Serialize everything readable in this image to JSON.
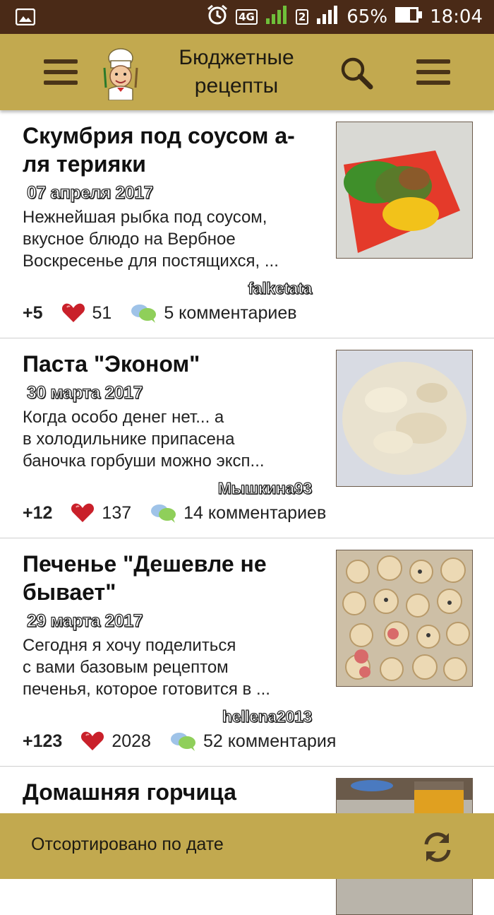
{
  "status_bar": {
    "network": "4G",
    "sim": "2",
    "battery": "65%",
    "time": "18:04"
  },
  "app": {
    "title_line1": "Бюджетные",
    "title_line2": "рецепты",
    "icons": [
      "menu-icon",
      "chef-logo",
      "search-icon",
      "menu-icon"
    ]
  },
  "recipes": [
    {
      "title_l1": "Скумбрия под соусом а-",
      "title_l2": "ля терияки",
      "date": "07 апреля 2017",
      "desc_l1": "Нежнейшая рыбка под соусом,",
      "desc_l2": "вкусное блюдо на Вербное",
      "desc_l3": "Воскресенье для постящихся, ...",
      "author": "falketata",
      "rating": "+5",
      "likes": "51",
      "comments": "5 комментариев"
    },
    {
      "title_l1": "Паста \"Эконом\"",
      "date": "30 марта 2017",
      "desc_l1": "Когда особо денег нет... а",
      "desc_l2": "в холодильнике припасена",
      "desc_l3": "баночка горбуши можно эксп...",
      "author": "Мышкина93",
      "rating": "+12",
      "likes": "137",
      "comments": "14 комментариев"
    },
    {
      "title_l1": "Печенье \"Дешевле не",
      "title_l2": "бывает\"",
      "date": "29 марта 2017",
      "desc_l1": "Сегодня я хочу поделиться",
      "desc_l2": "с вами базовым рецептом",
      "desc_l3": "печенья, которое готовится в ...",
      "author": "hellena2013",
      "rating": "+123",
      "likes": "2028",
      "comments": "52 комментария"
    },
    {
      "title_l1": "Домашняя горчица"
    }
  ],
  "bottom_bar": {
    "sort_label": "Отсортировано по дате"
  },
  "colors": {
    "appbar": "#c2a94f",
    "statusbar": "#4a2a17",
    "heart": "#c9202a"
  }
}
